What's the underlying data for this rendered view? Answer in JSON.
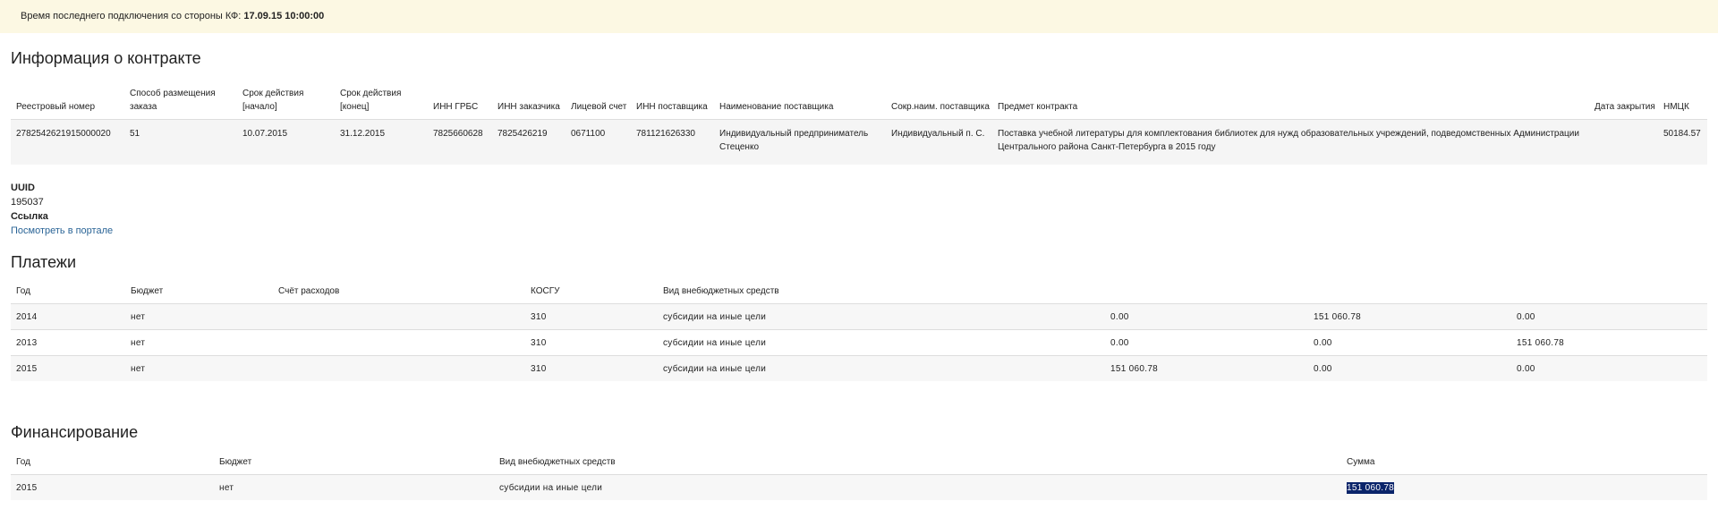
{
  "banner": {
    "label": "Время последнего подключения со стороны КФ:",
    "value": "17.09.15 10:00:00"
  },
  "contract": {
    "title": "Информация о контракте",
    "headers": [
      "Реестровый номер",
      "Способ размещения заказа",
      "Срок действия [начало]",
      "Срок действия [конец]",
      "ИНН ГРБС",
      "ИНН заказчика",
      "Лицевой счет",
      "ИНН поставщика",
      "Наименование поставщика",
      "Сокр.наим. поставщика",
      "Предмет контракта",
      "Дата закрытия",
      "НМЦК"
    ],
    "row": [
      "2782542621915000020",
      "51",
      "10.07.2015",
      "31.12.2015",
      "7825660628",
      "7825426219",
      "0671100",
      "781121626330",
      "Индивидуальный предприниматель Стеценко",
      "Индивидуальный п. С.",
      "Поставка учебной литературы для комплектования библиотек для нужд образовательных учреждений, подведомственных Администрации Центрального района Санкт-Петербурга в 2015 году",
      "",
      "50184.57"
    ]
  },
  "meta": {
    "uuid_label": "UUID",
    "uuid_value": "195037",
    "link_label": "Ссылка",
    "link_text": "Посмотреть в портале"
  },
  "payments": {
    "title": "Платежи",
    "headers": [
      "Год",
      "Бюджет",
      "Счёт расходов",
      "КОСГУ",
      "Вид внебюджетных средств",
      "",
      "",
      ""
    ],
    "rows": [
      [
        "2014",
        "нет",
        "",
        "310",
        "субсидии на иные цели",
        "0.00",
        "151 060.78",
        "0.00"
      ],
      [
        "2013",
        "нет",
        "",
        "310",
        "субсидии на иные цели",
        "0.00",
        "0.00",
        "151 060.78"
      ],
      [
        "2015",
        "нет",
        "",
        "310",
        "субсидии на иные цели",
        "151 060.78",
        "0.00",
        "0.00"
      ]
    ]
  },
  "financing": {
    "title": "Финансирование",
    "headers": [
      "Год",
      "Бюджет",
      "Вид внебюджетных средств",
      "Сумма"
    ],
    "rows": [
      [
        "2015",
        "нет",
        "субсидии на иные цели",
        "151 060.78"
      ]
    ]
  }
}
